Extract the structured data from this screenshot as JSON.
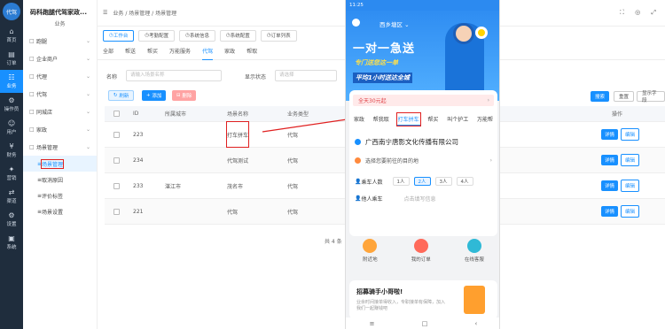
{
  "rail": {
    "logo": "代驾",
    "items": [
      {
        "label": "首页",
        "icon": "⌂"
      },
      {
        "label": "订单",
        "icon": "▤"
      },
      {
        "label": "业务",
        "icon": "☷"
      },
      {
        "label": "操作员",
        "icon": "⚙"
      },
      {
        "label": "用户",
        "icon": "☺"
      },
      {
        "label": "财务",
        "icon": "¥"
      },
      {
        "label": "营销",
        "icon": "✦"
      },
      {
        "label": "渠道",
        "icon": "⇄"
      },
      {
        "label": "设置",
        "icon": "⚙"
      },
      {
        "label": "系统",
        "icon": "▣"
      }
    ],
    "active_index": 2
  },
  "sidebar": {
    "brand": "码科跑腿代驾家政...",
    "sub": "业务",
    "items": [
      {
        "label": "跑腿",
        "icon": "□"
      },
      {
        "label": "企业商户",
        "icon": "□"
      },
      {
        "label": "代理",
        "icon": "□"
      },
      {
        "label": "代驾",
        "icon": "□"
      },
      {
        "label": "同城店",
        "icon": "□"
      },
      {
        "label": "家政",
        "icon": "□"
      },
      {
        "label": "场景管理",
        "icon": "□"
      }
    ],
    "children": [
      "场景管理",
      "取消原因",
      "评价标签",
      "场景设置"
    ],
    "active_child": 0
  },
  "topbar": {
    "crumb1": "业务",
    "crumb2": "场景管理",
    "crumb3": "场景管理",
    "right_icons": "⛶ ◎ ⤢"
  },
  "tabs": [
    "工作台",
    "考勤配置",
    "系统信息",
    "系统配置",
    "订单列表"
  ],
  "category_tabs": [
    "全部",
    "帮送",
    "帮买",
    "万能服务",
    "代驾",
    "家政",
    "帮取"
  ],
  "active_category": 4,
  "filters": {
    "name_label": "名称",
    "name_placeholder": "请输入场景名称",
    "status_label": "显示状态",
    "status_placeholder": "请选择",
    "search": "搜索",
    "reset": "重置",
    "show_hidden": "显示字段"
  },
  "actions": {
    "refresh": "刷新",
    "add": "添加",
    "delete": "删除"
  },
  "table": {
    "headers": [
      "ID",
      "所属城市",
      "场景名称",
      "业务类型",
      "显示状态",
      "排序",
      "创建时间",
      "操作"
    ],
    "rows": [
      {
        "id": "223",
        "city": "",
        "name": "打车拼车",
        "type": "代驾",
        "status": "显示",
        "status_on": true,
        "sort": "1",
        "date": "2022-12-12",
        "time": "13:51:41"
      },
      {
        "id": "234",
        "city": "",
        "name": "代驾测试",
        "type": "代驾",
        "status": "显示",
        "status_on": true,
        "sort": "0",
        "date": "2023-02-06",
        "time": "09:43:58"
      },
      {
        "id": "233",
        "city": "湛江市",
        "name": "茂名市",
        "type": "代驾",
        "status": "显示",
        "status_on": true,
        "sort": "0",
        "date": "2023-02-03",
        "time": "10:57:18"
      },
      {
        "id": "221",
        "city": "",
        "name": "代驾",
        "type": "代驾",
        "status": "隐藏",
        "status_on": false,
        "sort": "0",
        "date": "2022-12-11",
        "time": "13:04:20"
      }
    ],
    "row_action": "详情",
    "row_action2": "编辑"
  },
  "pager": "共 4 条",
  "phone": {
    "status_time": "11:25",
    "city": "西乡塘区",
    "city_chevron": "⌄",
    "title": "一对一急送",
    "slogan1": "专门送您这一单",
    "slogan2": "平均1小时送达全城",
    "promo": "全天30元起",
    "promo_arrow": "›",
    "service_tabs": [
      "家政",
      "帮我取",
      "打车拼车",
      "帮买",
      "叫个护工",
      "万能帮"
    ],
    "active_service": 2,
    "shop": "广西南宁唐影文化传播有限公司",
    "dest": "选择您要前往的目的地",
    "dest_arrow": "›",
    "people_label": "乘车人数",
    "people": [
      "1人",
      "2人",
      "3人",
      "4人"
    ],
    "people_selected": 1,
    "someone_label": "他人乘车",
    "someone_hint": "点击填写信息",
    "quick": [
      {
        "label": "附近地",
        "color": "#ffa53b"
      },
      {
        "label": "我的订单",
        "color": "#ff6a5a"
      },
      {
        "label": "在线客服",
        "color": "#2fb9d6"
      }
    ],
    "recruit_title": "招募骑手小哥啦!",
    "recruit_desc": "业余时间接单得收入，专职接单有保障，加入我们一起赚钱吧",
    "nav": [
      "≡",
      "□",
      "‹"
    ]
  },
  "colors": {
    "accent": "#1890ff",
    "rail": "#1f2d3d",
    "highlight": "#e02020"
  }
}
